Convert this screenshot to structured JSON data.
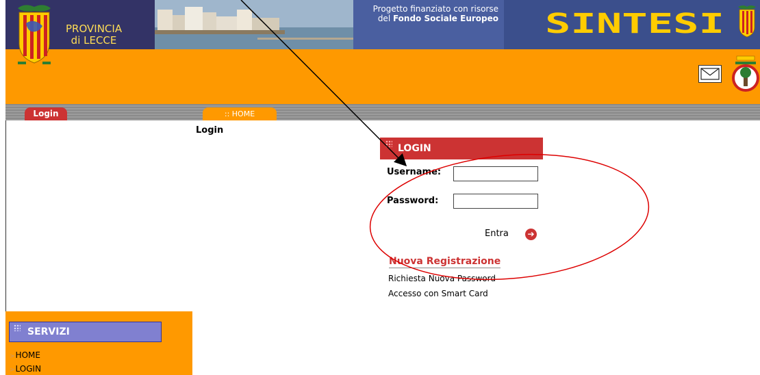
{
  "header": {
    "province_line1": "PROVINCIA",
    "province_line2": "di LECCE",
    "fse_line1": "Progetto finanziato con risorse",
    "fse_line2_prefix": "del ",
    "fse_line2_bold": "Fondo Sociale Europeo",
    "logo_text": "SINTESI"
  },
  "nav": {
    "login_tab": "Login",
    "home_tab": ":: HOME"
  },
  "main": {
    "page_title": "Login",
    "login_box": {
      "title": "LOGIN",
      "username_label": "Username:",
      "username_value": "",
      "password_label": "Password:",
      "password_value": "",
      "submit_label": "Entra"
    },
    "links": {
      "new_registration": "Nuova Registrazione",
      "new_password": "Richiesta Nuova Password",
      "smart_card": "Accesso con Smart Card"
    }
  },
  "sidebar": {
    "title": "SERVIZI",
    "items": [
      {
        "label": "HOME"
      },
      {
        "label": "LOGIN"
      }
    ]
  },
  "colors": {
    "header_orange": "#fe9900",
    "header_navy": "#333366",
    "login_red": "#cc3333",
    "servizi_purple": "#8080d0"
  }
}
